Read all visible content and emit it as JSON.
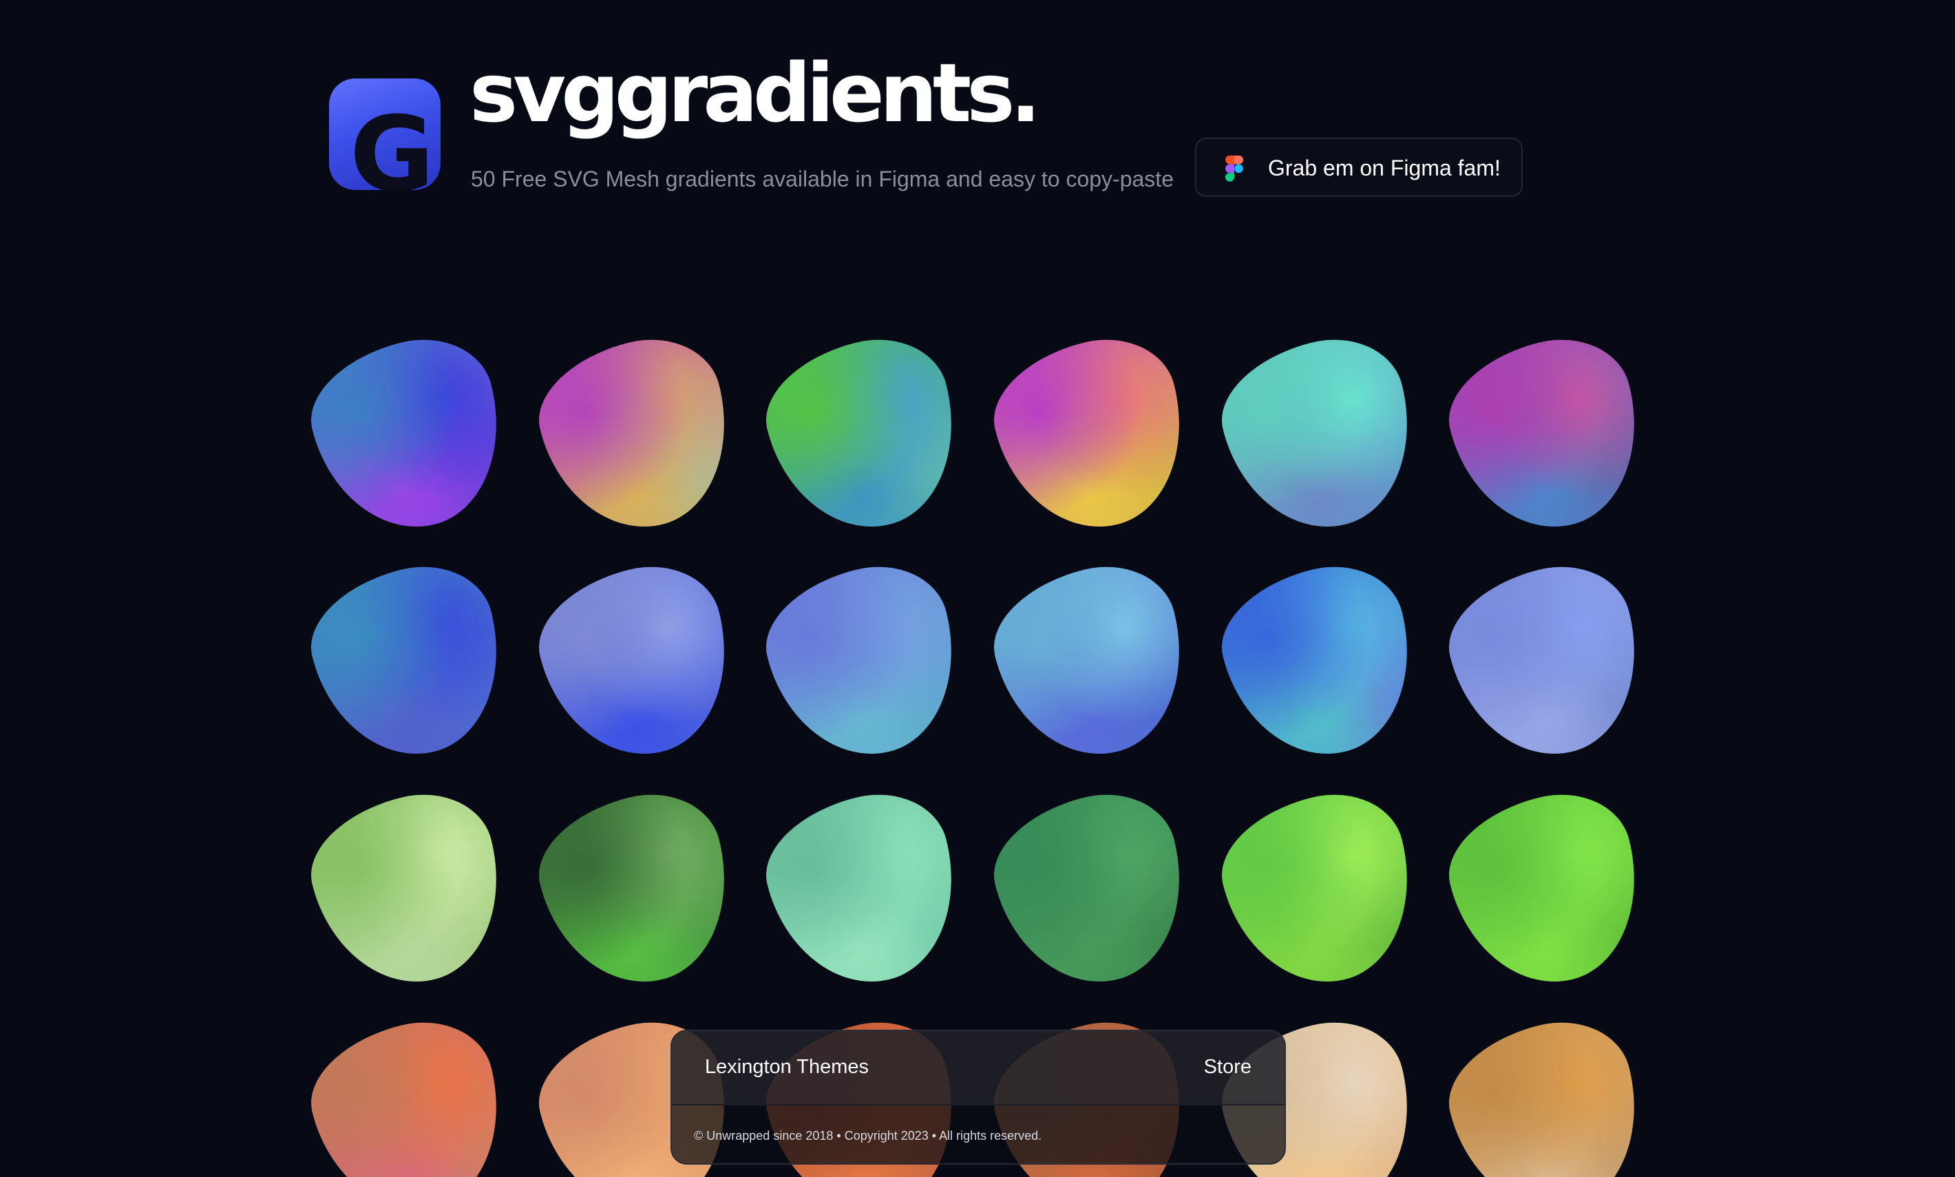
{
  "header": {
    "logo_letter": "G",
    "title": "svggradients.",
    "subtitle": "50 Free SVG Mesh gradients available in Figma and easy to copy-paste",
    "figma_button": {
      "icon": "figma-icon",
      "label": "Grab em on Figma fam!"
    }
  },
  "gradients": [
    {
      "colors": [
        "#3f7fc0",
        "#3b40d6",
        "#9a45e0",
        "#5b3fd0"
      ]
    },
    {
      "colors": [
        "#b046b8",
        "#d6a070",
        "#d8b25a",
        "#9dc0b2"
      ]
    },
    {
      "colors": [
        "#58c24a",
        "#4aa0c8",
        "#3f92c0",
        "#6fc7a8"
      ]
    },
    {
      "colors": [
        "#b542c0",
        "#e67b78",
        "#e9c94a",
        "#c7b04a"
      ]
    },
    {
      "colors": [
        "#63cdbd",
        "#6ee5d0",
        "#6e88c4",
        "#5e9dc8"
      ]
    },
    {
      "colors": [
        "#a93fae",
        "#c45aa0",
        "#4b88c8",
        "#6a5a9a"
      ]
    },
    {
      "colors": [
        "#3e8bbd",
        "#3a4ad6",
        "#5560c6",
        "#4a6ad0"
      ]
    },
    {
      "colors": [
        "#7f8ad0",
        "#93a2e4",
        "#3a50e0",
        "#5a6ad2"
      ]
    },
    {
      "colors": [
        "#6a7ad6",
        "#7aa0e0",
        "#6ab8d0",
        "#5aa0c8"
      ]
    },
    {
      "colors": [
        "#6aaed2",
        "#80c6e4",
        "#5a6ad6",
        "#4a70c8"
      ]
    },
    {
      "colors": [
        "#3a66d6",
        "#5ab8e0",
        "#56c0c8",
        "#6a6ad6"
      ]
    },
    {
      "colors": [
        "#7a8ad8",
        "#8aa0ec",
        "#9aa8e4",
        "#6a80c4"
      ]
    },
    {
      "colors": [
        "#8ac068",
        "#d0ecaa",
        "#b8d8a0",
        "#a0c880"
      ]
    },
    {
      "colors": [
        "#3a6a3a",
        "#78ae68",
        "#5ac046",
        "#4a8a48"
      ]
    },
    {
      "colors": [
        "#6abc9c",
        "#8ee2bc",
        "#9ae4c0",
        "#68c0a0"
      ]
    },
    {
      "colors": [
        "#3a8a58",
        "#54a86a",
        "#4a9a5e",
        "#3a7a4a"
      ]
    },
    {
      "colors": [
        "#64c84a",
        "#a8f060",
        "#88d84a",
        "#5aac3e"
      ]
    },
    {
      "colors": [
        "#60c042",
        "#8ae852",
        "#84e04a",
        "#58b03a"
      ]
    },
    {
      "colors": [
        "#c07a5a",
        "#e8744a",
        "#d46a7a",
        "#c88a60"
      ]
    },
    {
      "colors": [
        "#d08a6a",
        "#e8a472",
        "#f0b07a",
        "#d89a6a"
      ]
    },
    {
      "colors": [
        "#b85a3a",
        "#d86a40",
        "#e07848",
        "#b86040"
      ]
    },
    {
      "colors": [
        "#a06a4a",
        "#c0603a",
        "#d06a40",
        "#a05a3a"
      ]
    },
    {
      "colors": [
        "#d8c0a0",
        "#e8d8c4",
        "#f0c890",
        "#d8b088"
      ]
    },
    {
      "colors": [
        "#c08a4a",
        "#e0a050",
        "#d8b890",
        "#b89060"
      ]
    }
  ],
  "footer": {
    "brand": "Lexington Themes",
    "store": "Store",
    "copyright": "© Unwrapped since 2018 • Copyright 2023 • All rights reserved."
  }
}
